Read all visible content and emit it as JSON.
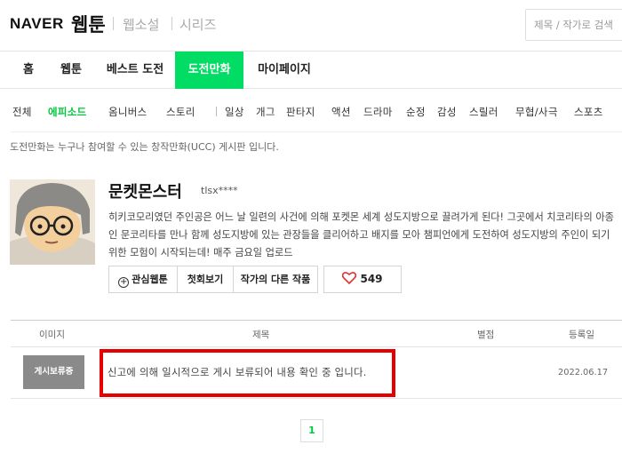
{
  "header": {
    "logo_naver": "NAVER",
    "logo_webtoon": "웹툰",
    "sub_links": [
      "웹소설",
      "시리즈"
    ],
    "search_placeholder": "제목 / 작가로 검색"
  },
  "main_nav": [
    "홈",
    "웹툰",
    "베스트 도전",
    "도전만화",
    "마이페이지"
  ],
  "main_nav_active": "도전만화",
  "sub_nav": [
    "전체",
    "에피소드",
    "옴니버스",
    "스토리",
    "일상",
    "개그",
    "판타지",
    "액션",
    "드라마",
    "순정",
    "감성",
    "스릴러",
    "무협/사극",
    "스포츠"
  ],
  "sub_nav_active": "에피소드",
  "notice": "도전만화는 누구나 참여할 수 있는 창작만화(UCC) 게시판 입니다.",
  "comic": {
    "title": "문켓몬스터",
    "author": "tlsx****",
    "description": "히키코모리였던 주인공은 어느 날 일련의 사건에 의해 포켓몬 세계 성도지방으로 끌려가게 된다! 그곳에서 치코리타의 아종인 문코리타를 만나 함께 성도지방에 있는 관장들을 클리어하고 배지를 모아 챔피언에게 도전하여 성도지방의 주인이 되기 위한 모험이 시작되는데! 매주 금요일 업로드",
    "buttons": {
      "interest": "관심웹툰",
      "first_view": "첫회보기",
      "other_works": "작가의 다른 작품"
    },
    "like_count": "549"
  },
  "table": {
    "headers": {
      "image": "이미지",
      "title": "제목",
      "rating": "별점",
      "date": "등록일"
    },
    "rows": [
      {
        "thumb_label": "게시보류중",
        "title": "신고에 의해 일시적으로 게시 보류되어 내용 확인 중 입니다.",
        "date": "2022.06.17"
      }
    ]
  },
  "pagination": {
    "current": "1"
  },
  "colors": {
    "accent": "#00dc64",
    "highlight_box": "#e60000"
  }
}
